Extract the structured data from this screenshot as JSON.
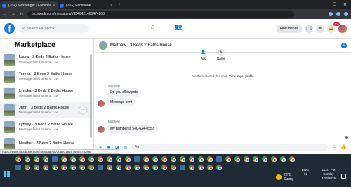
{
  "browser": {
    "tabs": [
      {
        "title": "(20+) Messenger | Facebook",
        "active": true
      },
      {
        "title": "(20+) Facebook",
        "active": false
      }
    ],
    "url": "facebook.com/messages/t/9546421465474288"
  },
  "header": {
    "logo": "f",
    "search_placeholder": "Search Facebook",
    "find_friends": "Find friends",
    "notif_badge": "20+"
  },
  "left": {
    "title": "Marketplace",
    "conversations": [
      {
        "name": "Laura · 3 Beds 2 Baths House",
        "msg": "Message failed to send · 1w"
      },
      {
        "name": "Teresa · 3 Beds 2 Baths House",
        "msg": "Message failed to send · 2w"
      },
      {
        "name": "Lynoka · 3 Beds 2 Baths House",
        "msg": "Message failed to send · 4w"
      },
      {
        "name": "Jhon · 3 Beds 2 Baths House",
        "msg": "Message failed to send · 4w"
      },
      {
        "name": "Lynsey · 3 Beds 2 Baths House",
        "msg": "Message failed to send · 4w"
      },
      {
        "name": "Heather · 3 Beds 2 Baths House",
        "msg": ""
      }
    ]
  },
  "chat": {
    "title": "Matthew · 3 Beds 2 Baths House",
    "actions": [
      {
        "label": "Add"
      },
      {
        "label": "Name"
      }
    ],
    "starter_text": "Matthew started this chat.",
    "starter_link": "View buyer profile",
    "groups": [
      {
        "sender": "Matthew",
        "messages": [
          "Do you allow pets",
          "Message sent"
        ]
      },
      {
        "sender": "Matthew",
        "messages": [
          "My number is 540-624-0557"
        ]
      }
    ],
    "composer_placeholder": "Aa"
  },
  "status_url": "https://www.facebook.com/messages/t/1059718207465474288/",
  "taskbar": {
    "weather_temp": "28°C",
    "weather_desc": "Sunny",
    "lang": "ENG",
    "region": "IN",
    "time": "11:07 PM",
    "day": "Sunday",
    "date": "4/13/2025"
  }
}
